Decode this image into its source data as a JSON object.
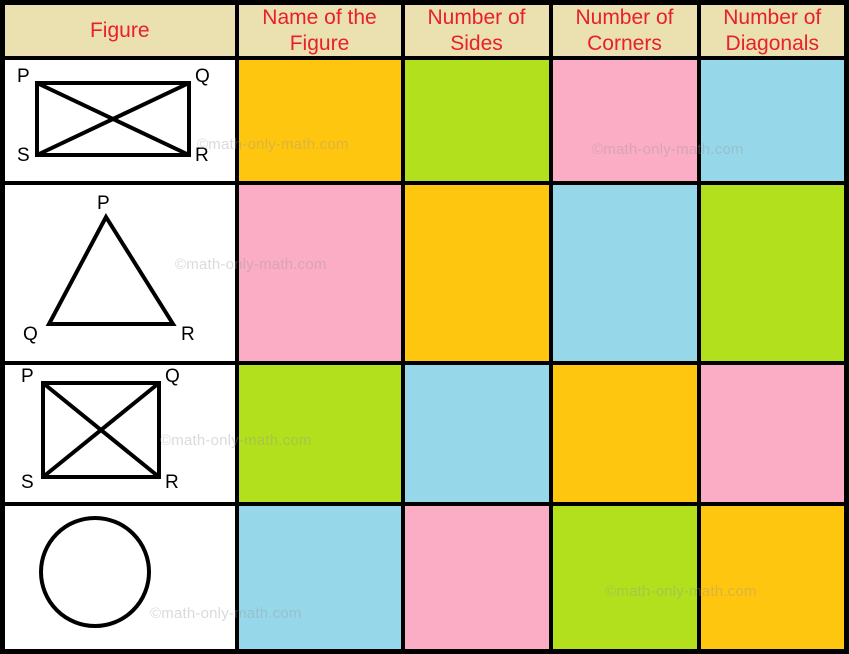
{
  "table": {
    "headers": [
      {
        "label": "Figure",
        "name": "header-figure"
      },
      {
        "label": "Name of the Figure",
        "name": "header-name-of-the-figure"
      },
      {
        "label": "Number of Sides",
        "name": "header-number-of-sides"
      },
      {
        "label": "Number of Corners",
        "name": "header-number-of-corners"
      },
      {
        "label": "Number of Diagonals",
        "name": "header-number-of-diagonals"
      }
    ],
    "header_background": "#EBE0B0",
    "header_text_color": "#E8202A",
    "border_color": "#000000",
    "rows": [
      {
        "figure": "rectangle-with-diagonals",
        "vertex_labels": {
          "top_left": "P",
          "top_right": "Q",
          "bottom_left": "S",
          "bottom_right": "R"
        },
        "name_cell": {
          "value": "",
          "color": "#FFC610"
        },
        "sides_cell": {
          "value": "",
          "color": "#B2E01C"
        },
        "corners_cell": {
          "value": "",
          "color": "#FBADC6"
        },
        "diagonals_cell": {
          "value": "",
          "color": "#96D8EA"
        }
      },
      {
        "figure": "triangle",
        "vertex_labels": {
          "apex": "P",
          "bottom_left": "Q",
          "bottom_right": "R"
        },
        "name_cell": {
          "value": "",
          "color": "#FBADC6"
        },
        "sides_cell": {
          "value": "",
          "color": "#FFC610"
        },
        "corners_cell": {
          "value": "",
          "color": "#96D8EA"
        },
        "diagonals_cell": {
          "value": "",
          "color": "#B2E01C"
        }
      },
      {
        "figure": "square-with-diagonals",
        "vertex_labels": {
          "top_left": "P",
          "top_right": "Q",
          "bottom_left": "S",
          "bottom_right": "R"
        },
        "name_cell": {
          "value": "",
          "color": "#B2E01C"
        },
        "sides_cell": {
          "value": "",
          "color": "#96D8EA"
        },
        "corners_cell": {
          "value": "",
          "color": "#FFC610"
        },
        "diagonals_cell": {
          "value": "",
          "color": "#FBADC6"
        }
      },
      {
        "figure": "circle",
        "vertex_labels": {},
        "name_cell": {
          "value": "",
          "color": "#96D8EA"
        },
        "sides_cell": {
          "value": "",
          "color": "#FBADC6"
        },
        "corners_cell": {
          "value": "",
          "color": "#B2E01C"
        },
        "diagonals_cell": {
          "value": "",
          "color": "#FFC610"
        }
      }
    ]
  },
  "watermark": {
    "text": "©math-only-math.com",
    "occurrences": 6
  },
  "figure_labels": {
    "r1_P": "P",
    "r1_Q": "Q",
    "r1_S": "S",
    "r1_R": "R",
    "r2_P": "P",
    "r2_Q": "Q",
    "r2_R": "R",
    "r3_P": "P",
    "r3_Q": "Q",
    "r3_S": "S",
    "r3_R": "R"
  }
}
